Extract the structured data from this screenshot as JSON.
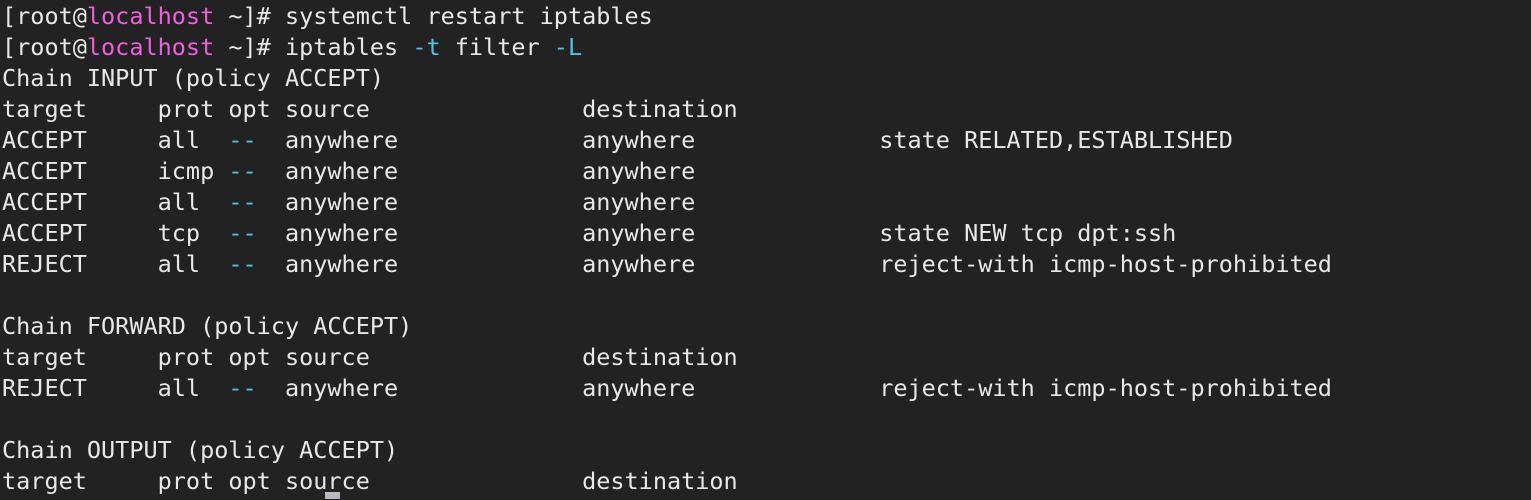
{
  "terminal": {
    "title": "Terminal",
    "background_color": "#222222",
    "foreground_color": "#e8e8e8",
    "prompt_host_color": "#f15ee0",
    "flag_color": "#4fc3e8",
    "columns": 96,
    "rows": 16,
    "cursor": {
      "visible": true,
      "shape": "underline-block",
      "color": "#b9b9c4"
    },
    "lines": [
      {
        "id": "line-1-prompt-systemctl",
        "segments": [
          {
            "text": "[root@",
            "color": "default"
          },
          {
            "text": "localhost",
            "color": "magenta"
          },
          {
            "text": " ~]# systemctl restart iptables",
            "color": "default"
          }
        ]
      },
      {
        "id": "line-2-prompt-iptables",
        "segments": [
          {
            "text": "[root@",
            "color": "default"
          },
          {
            "text": "localhost",
            "color": "magenta"
          },
          {
            "text": " ~]# iptables ",
            "color": "default"
          },
          {
            "text": "-t",
            "color": "cyan"
          },
          {
            "text": " filter ",
            "color": "default"
          },
          {
            "text": "-L",
            "color": "cyan"
          }
        ]
      },
      {
        "id": "line-3-chain-input",
        "segments": [
          {
            "text": "Chain INPUT (policy ACCEPT)",
            "color": "default"
          }
        ]
      },
      {
        "id": "line-4-header-input",
        "segments": [
          {
            "text": "target     prot opt source               destination",
            "color": "default"
          }
        ]
      },
      {
        "id": "line-5-rule-input-1",
        "segments": [
          {
            "text": "ACCEPT     all  ",
            "color": "default"
          },
          {
            "text": "--",
            "color": "cyan"
          },
          {
            "text": "  anywhere             anywhere             state RELATED,ESTABLISHED",
            "color": "default"
          }
        ]
      },
      {
        "id": "line-6-rule-input-2",
        "segments": [
          {
            "text": "ACCEPT     icmp ",
            "color": "default"
          },
          {
            "text": "--",
            "color": "cyan"
          },
          {
            "text": "  anywhere             anywhere",
            "color": "default"
          }
        ]
      },
      {
        "id": "line-7-rule-input-3",
        "segments": [
          {
            "text": "ACCEPT     all  ",
            "color": "default"
          },
          {
            "text": "--",
            "color": "cyan"
          },
          {
            "text": "  anywhere             anywhere",
            "color": "default"
          }
        ]
      },
      {
        "id": "line-8-rule-input-4",
        "segments": [
          {
            "text": "ACCEPT     tcp  ",
            "color": "default"
          },
          {
            "text": "--",
            "color": "cyan"
          },
          {
            "text": "  anywhere             anywhere             state NEW tcp dpt:ssh",
            "color": "default"
          }
        ]
      },
      {
        "id": "line-9-rule-input-5",
        "segments": [
          {
            "text": "REJECT     all  ",
            "color": "default"
          },
          {
            "text": "--",
            "color": "cyan"
          },
          {
            "text": "  anywhere             anywhere             reject-with icmp-host-prohibited",
            "color": "default"
          }
        ]
      },
      {
        "id": "line-10-blank",
        "segments": [
          {
            "text": " ",
            "color": "default"
          }
        ]
      },
      {
        "id": "line-11-chain-forward",
        "segments": [
          {
            "text": "Chain FORWARD (policy ACCEPT)",
            "color": "default"
          }
        ]
      },
      {
        "id": "line-12-header-forward",
        "segments": [
          {
            "text": "target     prot opt source               destination",
            "color": "default"
          }
        ]
      },
      {
        "id": "line-13-rule-forward-1",
        "segments": [
          {
            "text": "REJECT     all  ",
            "color": "default"
          },
          {
            "text": "--",
            "color": "cyan"
          },
          {
            "text": "  anywhere             anywhere             reject-with icmp-host-prohibited",
            "color": "default"
          }
        ]
      },
      {
        "id": "line-14-blank",
        "segments": [
          {
            "text": " ",
            "color": "default"
          }
        ]
      },
      {
        "id": "line-15-chain-output",
        "segments": [
          {
            "text": "Chain OUTPUT (policy ACCEPT)",
            "color": "default"
          }
        ]
      },
      {
        "id": "line-16-header-output",
        "segments": [
          {
            "text": "target     prot opt source               destination",
            "color": "default"
          }
        ]
      }
    ]
  }
}
